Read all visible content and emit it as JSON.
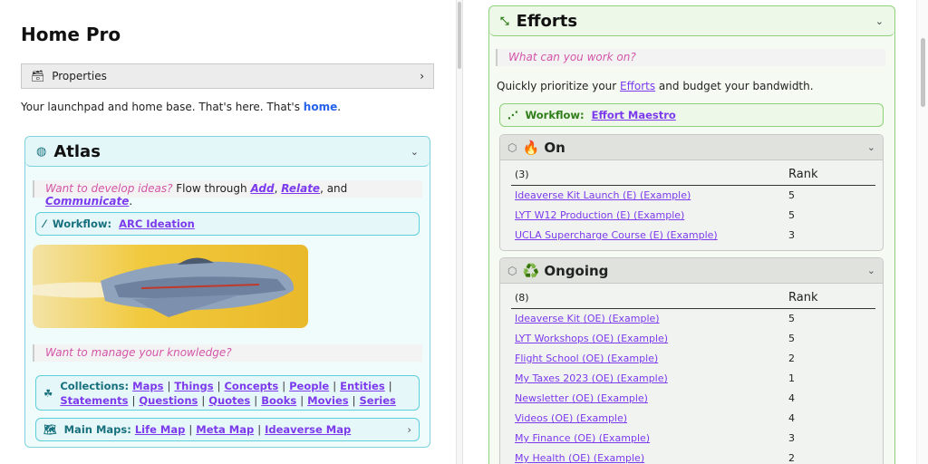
{
  "left": {
    "title": "Home Pro",
    "properties_label": "Properties",
    "intro": {
      "text": "Your launchpad and home base. That's here. That's ",
      "link": "home",
      "end": "."
    },
    "atlas": {
      "title": "Atlas",
      "quote1": {
        "question": "Want to develop ideas?",
        "text": " Flow through ",
        "links": [
          "Add",
          "Relate",
          "Communicate"
        ],
        "and": ", and ",
        "comma": ", ",
        "end": "."
      },
      "workflow": {
        "label": "Workflow:",
        "link": "ARC Ideation"
      },
      "quote2": "Want to manage your knowledge?",
      "collections": {
        "label": "Collections:",
        "links": [
          "Maps",
          "Things",
          "Concepts",
          "People",
          "Entities",
          "Statements",
          "Questions",
          "Quotes",
          "Books",
          "Movies",
          "Series"
        ]
      },
      "main_maps": {
        "label": "Main Maps:",
        "links": [
          "Life Map",
          "Meta Map",
          "Ideaverse Map"
        ]
      }
    }
  },
  "right": {
    "efforts": {
      "title": "Efforts",
      "quote": "What can you work on?",
      "desc": {
        "pre": "Quickly prioritize your ",
        "link": "Efforts",
        "post": " and budget your bandwidth."
      },
      "workflow": {
        "label": "Workflow:",
        "link": "Effort Maestro"
      },
      "on": {
        "title": "🔥 On",
        "count": "(3)",
        "rank_header": "Rank",
        "rows": [
          {
            "name": "Ideaverse Kit Launch (E) (Example)",
            "rank": "5"
          },
          {
            "name": "LYT W12 Production (E) (Example)",
            "rank": "5"
          },
          {
            "name": "UCLA Supercharge Course (E) (Example)",
            "rank": "3"
          }
        ]
      },
      "ongoing": {
        "title": "♻️ Ongoing",
        "count": "(8)",
        "rank_header": "Rank",
        "rows": [
          {
            "name": "Ideaverse Kit (OE) (Example)",
            "rank": "5"
          },
          {
            "name": "LYT Workshops (OE) (Example)",
            "rank": "5"
          },
          {
            "name": "Flight School (OE) (Example)",
            "rank": "2"
          },
          {
            "name": "My Taxes 2023 (OE) (Example)",
            "rank": "1"
          },
          {
            "name": "Newsletter (OE) (Example)",
            "rank": "4"
          },
          {
            "name": "Videos (OE) (Example)",
            "rank": "4"
          },
          {
            "name": "My Finance (OE) (Example)",
            "rank": "3"
          },
          {
            "name": "My Health (OE) (Example)",
            "rank": "2"
          }
        ]
      }
    }
  }
}
